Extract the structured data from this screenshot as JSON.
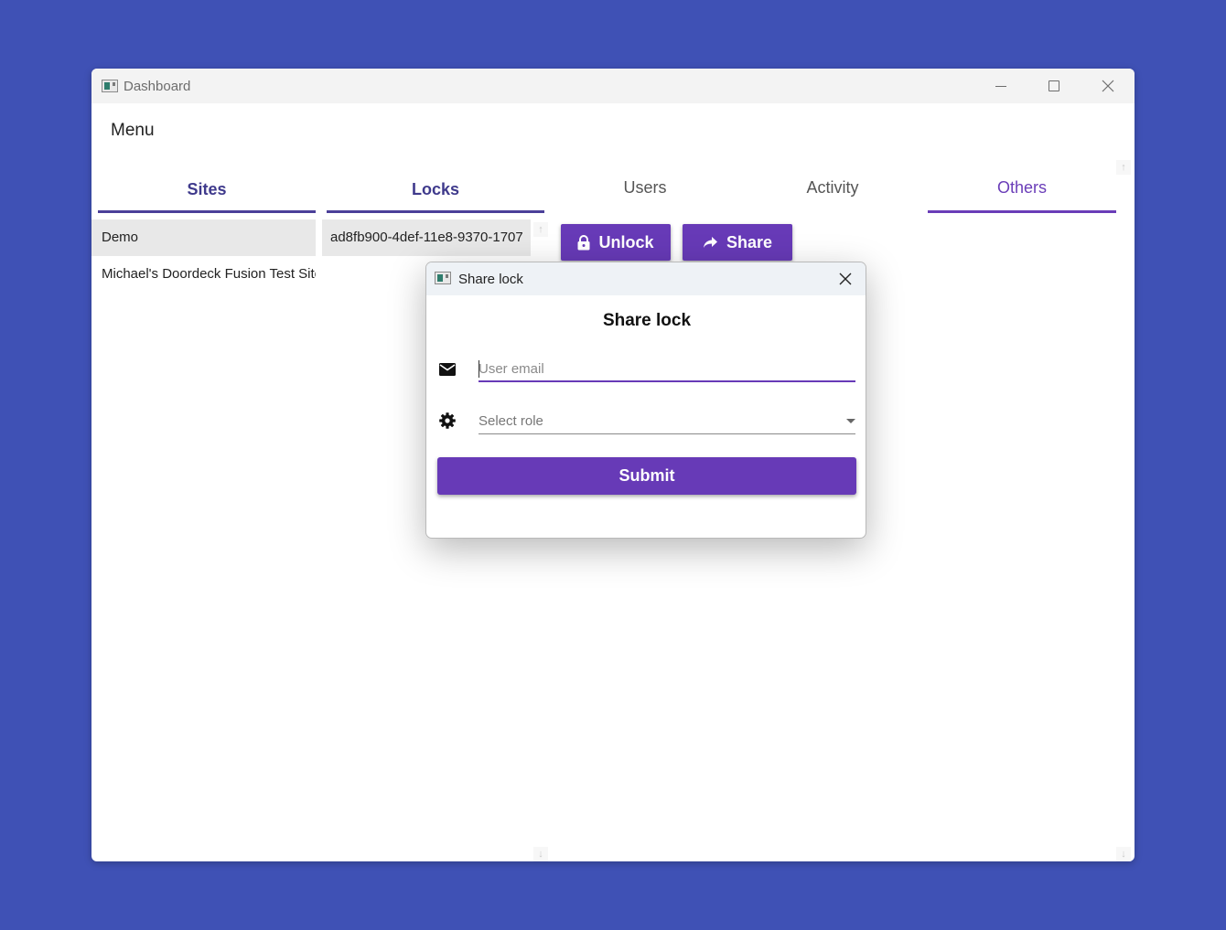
{
  "window": {
    "title": "Dashboard"
  },
  "menu": {
    "label": "Menu"
  },
  "tabs": [
    {
      "label": "Sites"
    },
    {
      "label": "Locks"
    },
    {
      "label": "Users"
    },
    {
      "label": "Activity"
    },
    {
      "label": "Others"
    }
  ],
  "sites": [
    {
      "name": "Demo"
    },
    {
      "name": "Michael's Doordeck Fusion Test Site"
    }
  ],
  "locks": [
    {
      "id": "ad8fb900-4def-11e8-9370-1707"
    }
  ],
  "actions": {
    "unlock_label": "Unlock",
    "share_label": "Share"
  },
  "dialog": {
    "window_title": "Share lock",
    "heading": "Share lock",
    "email_placeholder": "User email",
    "role_placeholder": "Select role",
    "submit_label": "Submit"
  },
  "colors": {
    "background": "#3f51b5",
    "primary": "#673ab7",
    "tab_indicator": "#4b3f99"
  }
}
